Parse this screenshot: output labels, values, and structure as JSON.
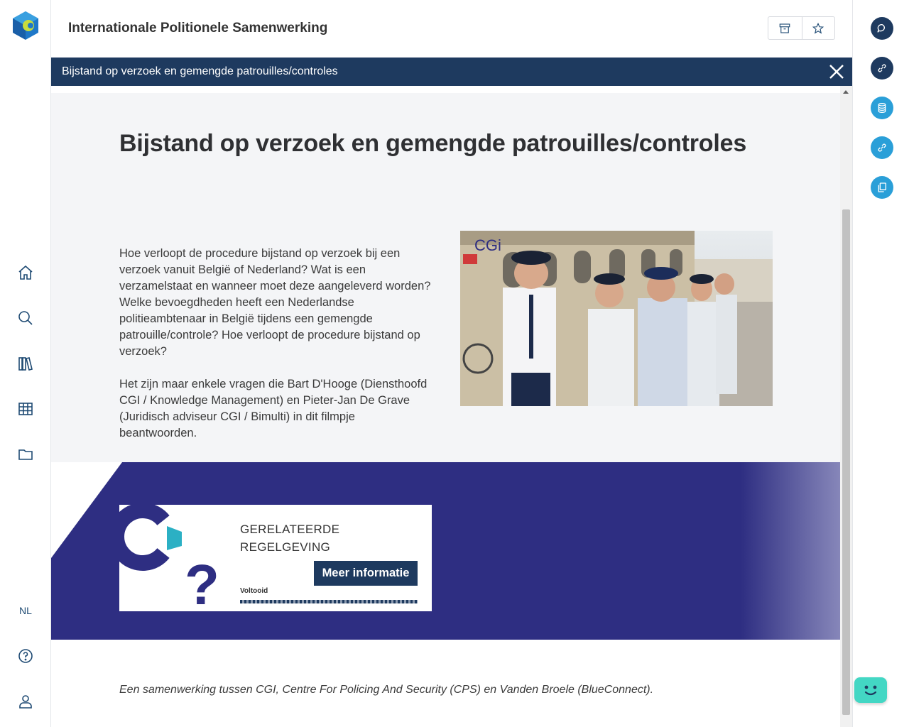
{
  "header": {
    "app_title": "Internationale Politionele Samenwerking"
  },
  "topic_bar": {
    "label": "Bijstand op verzoek en gemengde patrouilles/controles"
  },
  "main": {
    "heading": "Bijstand op verzoek en gemengde patrouilles/controles",
    "paragraph1": "Hoe verloopt de procedure bijstand op verzoek bij een verzoek vanuit België of Nederland? Wat is een verzamelstaat en wanneer moet deze aangeleverd worden? Welke bevoegdheden heeft een Nederlandse politieambtenaar in België tijdens een gemengde patrouille/controle? Hoe verloopt de procedure bijstand op verzoek?",
    "paragraph2": "Het zijn maar enkele vragen die Bart D'Hooge (Diensthoofd CGI / Knowledge Management)  en Pieter-Jan De Grave (Juridisch adviseur CGI / Bimulti) in dit filmpje beantwoorden.",
    "video_watermark": "CGi"
  },
  "card": {
    "title_line1": "GERELATEERDE",
    "title_line2": "REGELGEVING",
    "button_label": "Meer informatie",
    "status": "Voltooid",
    "progress": 1.0
  },
  "footer": {
    "text": "Een samenwerking tussen CGI, Centre For Policing And Security (CPS) en Vanden Broele (BlueConnect)."
  },
  "left_rail": {
    "language": "NL",
    "icons": [
      "home-icon",
      "search-icon",
      "library-icon",
      "grid-icon",
      "folder-icon",
      "help-icon",
      "user-icon"
    ]
  },
  "right_rail": {
    "icons": [
      "comment-icon",
      "link-icon",
      "database-icon",
      "link-icon",
      "copy-icon"
    ]
  },
  "colors": {
    "navy": "#1e3a5f",
    "indigo_band": "#2e2e82",
    "light_blue": "#2a9fd8",
    "chatbot": "#43d7c4",
    "light_bg": "#f4f5f7"
  }
}
